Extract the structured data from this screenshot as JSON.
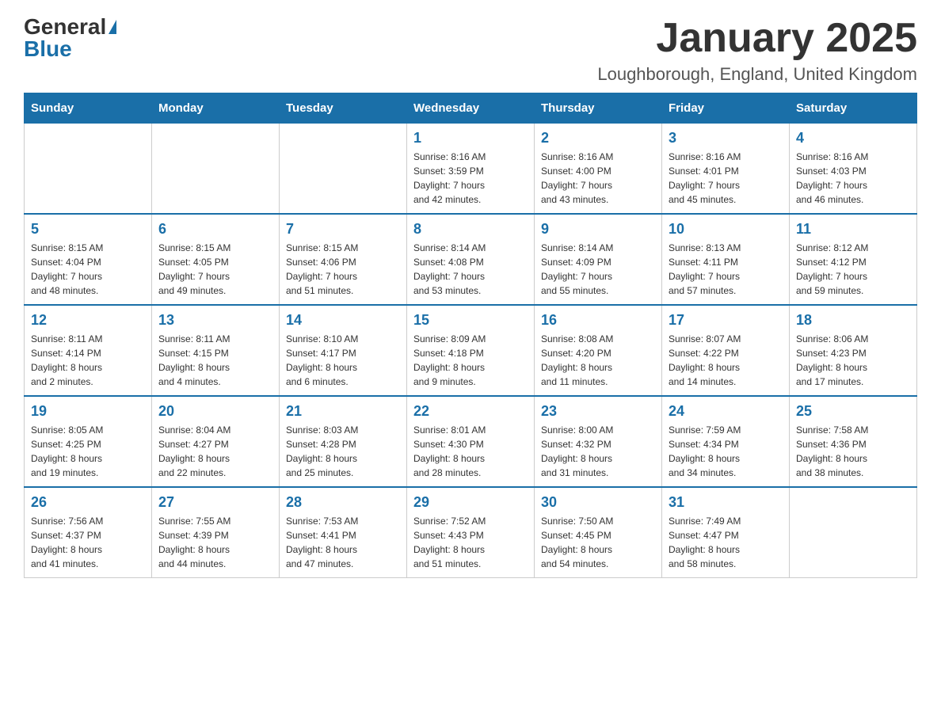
{
  "header": {
    "logo_general": "General",
    "logo_blue": "Blue",
    "month_title": "January 2025",
    "location": "Loughborough, England, United Kingdom"
  },
  "weekdays": [
    "Sunday",
    "Monday",
    "Tuesday",
    "Wednesday",
    "Thursday",
    "Friday",
    "Saturday"
  ],
  "weeks": [
    [
      {
        "day": "",
        "info": ""
      },
      {
        "day": "",
        "info": ""
      },
      {
        "day": "",
        "info": ""
      },
      {
        "day": "1",
        "info": "Sunrise: 8:16 AM\nSunset: 3:59 PM\nDaylight: 7 hours\nand 42 minutes."
      },
      {
        "day": "2",
        "info": "Sunrise: 8:16 AM\nSunset: 4:00 PM\nDaylight: 7 hours\nand 43 minutes."
      },
      {
        "day": "3",
        "info": "Sunrise: 8:16 AM\nSunset: 4:01 PM\nDaylight: 7 hours\nand 45 minutes."
      },
      {
        "day": "4",
        "info": "Sunrise: 8:16 AM\nSunset: 4:03 PM\nDaylight: 7 hours\nand 46 minutes."
      }
    ],
    [
      {
        "day": "5",
        "info": "Sunrise: 8:15 AM\nSunset: 4:04 PM\nDaylight: 7 hours\nand 48 minutes."
      },
      {
        "day": "6",
        "info": "Sunrise: 8:15 AM\nSunset: 4:05 PM\nDaylight: 7 hours\nand 49 minutes."
      },
      {
        "day": "7",
        "info": "Sunrise: 8:15 AM\nSunset: 4:06 PM\nDaylight: 7 hours\nand 51 minutes."
      },
      {
        "day": "8",
        "info": "Sunrise: 8:14 AM\nSunset: 4:08 PM\nDaylight: 7 hours\nand 53 minutes."
      },
      {
        "day": "9",
        "info": "Sunrise: 8:14 AM\nSunset: 4:09 PM\nDaylight: 7 hours\nand 55 minutes."
      },
      {
        "day": "10",
        "info": "Sunrise: 8:13 AM\nSunset: 4:11 PM\nDaylight: 7 hours\nand 57 minutes."
      },
      {
        "day": "11",
        "info": "Sunrise: 8:12 AM\nSunset: 4:12 PM\nDaylight: 7 hours\nand 59 minutes."
      }
    ],
    [
      {
        "day": "12",
        "info": "Sunrise: 8:11 AM\nSunset: 4:14 PM\nDaylight: 8 hours\nand 2 minutes."
      },
      {
        "day": "13",
        "info": "Sunrise: 8:11 AM\nSunset: 4:15 PM\nDaylight: 8 hours\nand 4 minutes."
      },
      {
        "day": "14",
        "info": "Sunrise: 8:10 AM\nSunset: 4:17 PM\nDaylight: 8 hours\nand 6 minutes."
      },
      {
        "day": "15",
        "info": "Sunrise: 8:09 AM\nSunset: 4:18 PM\nDaylight: 8 hours\nand 9 minutes."
      },
      {
        "day": "16",
        "info": "Sunrise: 8:08 AM\nSunset: 4:20 PM\nDaylight: 8 hours\nand 11 minutes."
      },
      {
        "day": "17",
        "info": "Sunrise: 8:07 AM\nSunset: 4:22 PM\nDaylight: 8 hours\nand 14 minutes."
      },
      {
        "day": "18",
        "info": "Sunrise: 8:06 AM\nSunset: 4:23 PM\nDaylight: 8 hours\nand 17 minutes."
      }
    ],
    [
      {
        "day": "19",
        "info": "Sunrise: 8:05 AM\nSunset: 4:25 PM\nDaylight: 8 hours\nand 19 minutes."
      },
      {
        "day": "20",
        "info": "Sunrise: 8:04 AM\nSunset: 4:27 PM\nDaylight: 8 hours\nand 22 minutes."
      },
      {
        "day": "21",
        "info": "Sunrise: 8:03 AM\nSunset: 4:28 PM\nDaylight: 8 hours\nand 25 minutes."
      },
      {
        "day": "22",
        "info": "Sunrise: 8:01 AM\nSunset: 4:30 PM\nDaylight: 8 hours\nand 28 minutes."
      },
      {
        "day": "23",
        "info": "Sunrise: 8:00 AM\nSunset: 4:32 PM\nDaylight: 8 hours\nand 31 minutes."
      },
      {
        "day": "24",
        "info": "Sunrise: 7:59 AM\nSunset: 4:34 PM\nDaylight: 8 hours\nand 34 minutes."
      },
      {
        "day": "25",
        "info": "Sunrise: 7:58 AM\nSunset: 4:36 PM\nDaylight: 8 hours\nand 38 minutes."
      }
    ],
    [
      {
        "day": "26",
        "info": "Sunrise: 7:56 AM\nSunset: 4:37 PM\nDaylight: 8 hours\nand 41 minutes."
      },
      {
        "day": "27",
        "info": "Sunrise: 7:55 AM\nSunset: 4:39 PM\nDaylight: 8 hours\nand 44 minutes."
      },
      {
        "day": "28",
        "info": "Sunrise: 7:53 AM\nSunset: 4:41 PM\nDaylight: 8 hours\nand 47 minutes."
      },
      {
        "day": "29",
        "info": "Sunrise: 7:52 AM\nSunset: 4:43 PM\nDaylight: 8 hours\nand 51 minutes."
      },
      {
        "day": "30",
        "info": "Sunrise: 7:50 AM\nSunset: 4:45 PM\nDaylight: 8 hours\nand 54 minutes."
      },
      {
        "day": "31",
        "info": "Sunrise: 7:49 AM\nSunset: 4:47 PM\nDaylight: 8 hours\nand 58 minutes."
      },
      {
        "day": "",
        "info": ""
      }
    ]
  ]
}
